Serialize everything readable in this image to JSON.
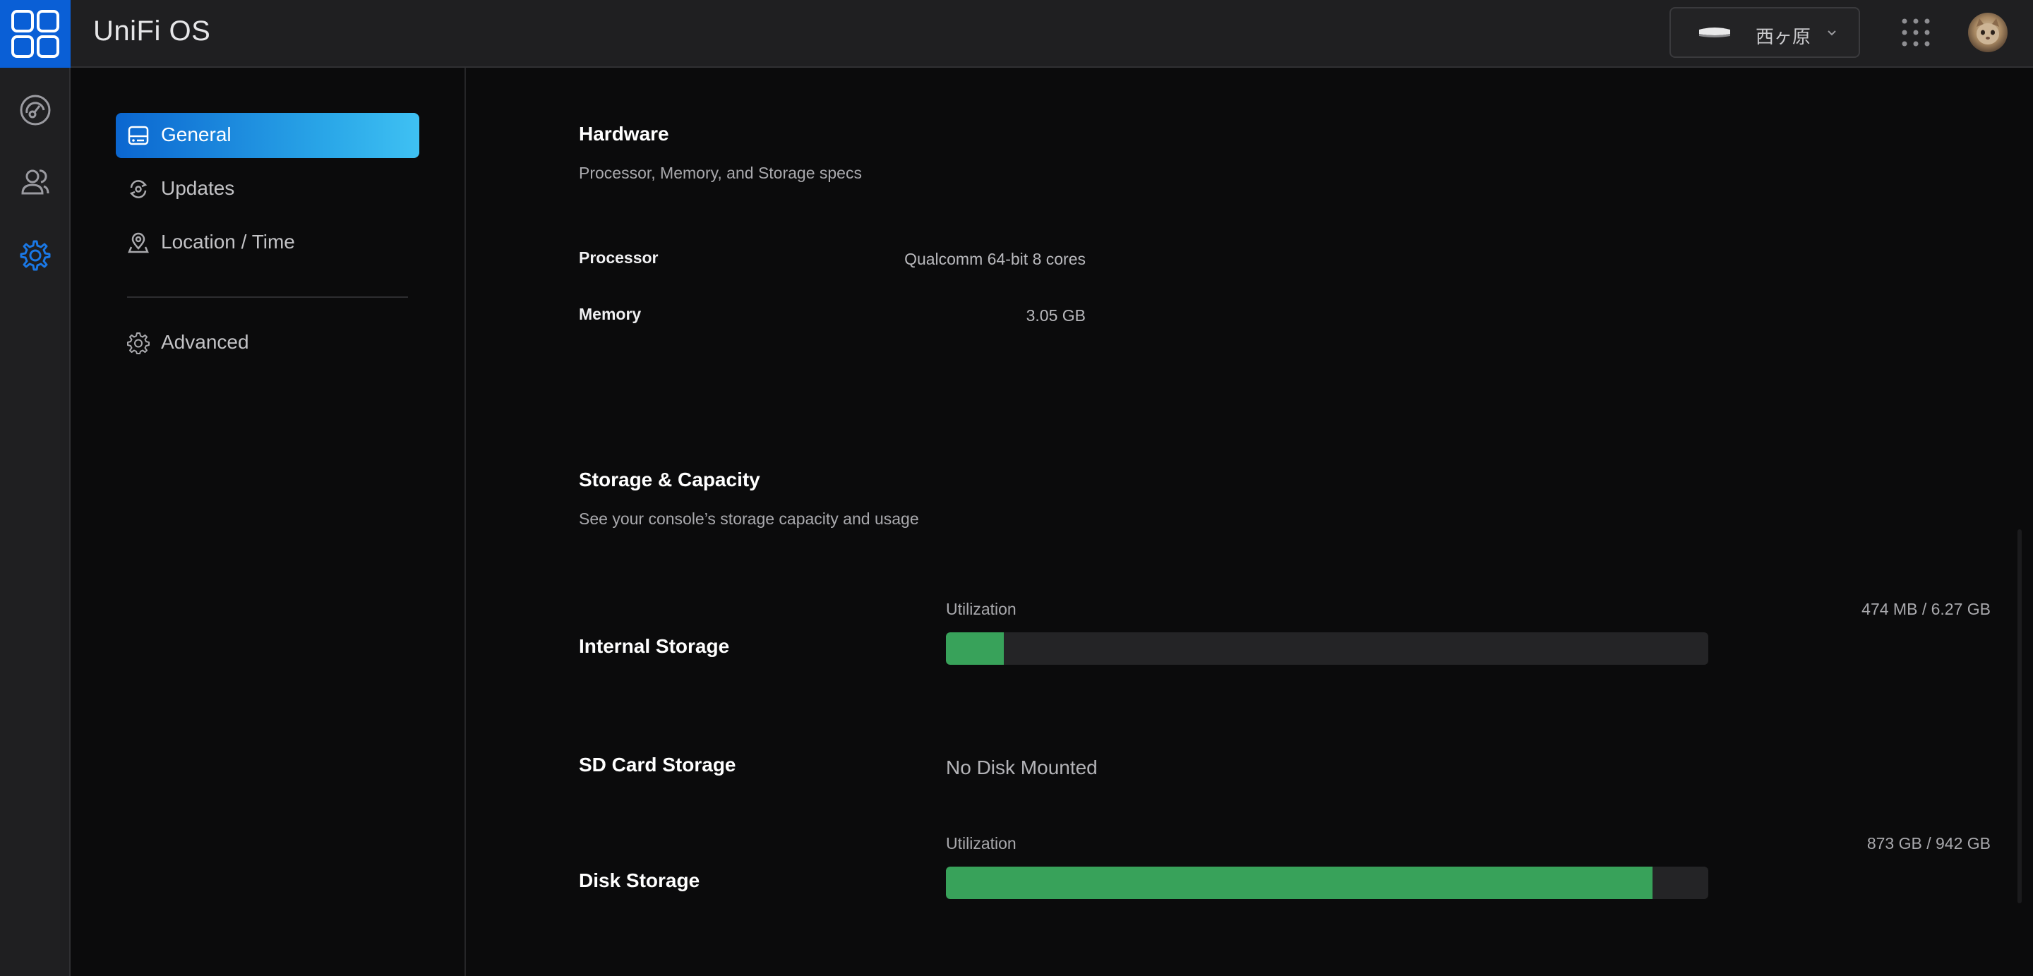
{
  "app": {
    "title": "UniFi OS"
  },
  "header": {
    "device_name": "西ヶ原",
    "icons": {
      "logo": "unifi-apps-logo-icon",
      "device": "console-device-icon",
      "chevron": "chevron-down-icon",
      "apps": "apps-grid-icon",
      "avatar": "user-avatar"
    }
  },
  "rail": {
    "items": [
      {
        "name": "dashboard",
        "icon": "gauge-icon"
      },
      {
        "name": "users",
        "icon": "users-icon"
      },
      {
        "name": "settings",
        "icon": "gear-icon",
        "active": true
      }
    ]
  },
  "settings_nav": {
    "items": [
      {
        "label": "General",
        "icon": "storage-drive-icon",
        "active": true
      },
      {
        "label": "Updates",
        "icon": "refresh-icon"
      },
      {
        "label": "Location / Time",
        "icon": "map-pin-icon"
      },
      {
        "label": "Advanced",
        "icon": "gear-icon"
      }
    ]
  },
  "hardware": {
    "title": "Hardware",
    "subtitle": "Processor, Memory, and Storage specs",
    "specs": [
      {
        "label": "Processor",
        "value": "Qualcomm 64-bit 8 cores"
      },
      {
        "label": "Memory",
        "value": "3.05 GB"
      }
    ]
  },
  "storage": {
    "title": "Storage & Capacity",
    "subtitle": "See your console’s storage capacity and usage",
    "internal": {
      "label": "Internal Storage",
      "util_label": "Utilization",
      "util_value": "474 MB / 6.27 GB",
      "fraction": 0.0756
    },
    "sd_card": {
      "label": "SD Card Storage",
      "status": "No Disk Mounted"
    },
    "disk": {
      "label": "Disk Storage",
      "util_label": "Utilization",
      "util_value": "873 GB / 942 GB",
      "fraction": 0.9268
    }
  },
  "colors": {
    "accent": "#0a5fd6",
    "active_gradient_start": "#0b66d0",
    "active_gradient_end": "#3fc1f3",
    "bar_fill": "#38a25a",
    "bar_track": "#242426",
    "background": "#0b0b0c",
    "panel": "#1f1f21"
  }
}
